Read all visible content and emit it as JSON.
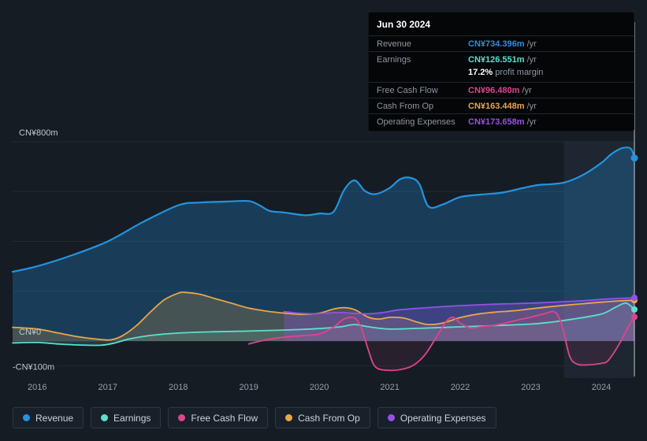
{
  "tooltip": {
    "date": "Jun 30 2024",
    "rows": [
      {
        "label": "Revenue",
        "value": "CN¥734.396m",
        "suffix": "/yr",
        "color": "#2394DF"
      },
      {
        "label": "Earnings",
        "value": "CN¥126.551m",
        "suffix": "/yr",
        "color": "#5BE0CE"
      },
      {
        "label": "Free Cash Flow",
        "value": "CN¥96.480m",
        "suffix": "/yr",
        "color": "#E0448C"
      },
      {
        "label": "Cash From Op",
        "value": "CN¥163.448m",
        "suffix": "/yr",
        "color": "#E9A64C"
      },
      {
        "label": "Operating Expenses",
        "value": "CN¥173.658m",
        "suffix": "/yr",
        "color": "#9650E8"
      }
    ],
    "profit_margin": {
      "value": "17.2%",
      "text": "profit margin"
    }
  },
  "chart_data": {
    "type": "area",
    "unit": "CN¥ millions per year",
    "x_ticks": [
      "2016",
      "2017",
      "2018",
      "2019",
      "2020",
      "2021",
      "2022",
      "2023",
      "2024"
    ],
    "y_ticks": [
      {
        "value": 800,
        "label": "CN¥800m"
      },
      {
        "value": 0,
        "label": "CN¥0"
      },
      {
        "value": -100,
        "label": "-CN¥100m"
      }
    ],
    "gridline_values": [
      800,
      600,
      400,
      200,
      0,
      -100
    ],
    "x_range": [
      2015.65,
      2024.47
    ],
    "y_range": [
      -150,
      800
    ],
    "highlight_region": {
      "from": 2023.47,
      "to": 2024.47
    },
    "series": [
      {
        "name": "Revenue",
        "color": "#2394DF",
        "current": "CN¥734.396m /yr",
        "points": [
          [
            2015.65,
            278
          ],
          [
            2016,
            300
          ],
          [
            2016.5,
            345
          ],
          [
            2017,
            400
          ],
          [
            2017.5,
            478
          ],
          [
            2018,
            545
          ],
          [
            2018.3,
            556
          ],
          [
            2018.7,
            560
          ],
          [
            2019,
            562
          ],
          [
            2019.15,
            545
          ],
          [
            2019.3,
            522
          ],
          [
            2019.5,
            516
          ],
          [
            2019.8,
            505
          ],
          [
            2020,
            512
          ],
          [
            2020.2,
            518
          ],
          [
            2020.35,
            605
          ],
          [
            2020.5,
            645
          ],
          [
            2020.65,
            602
          ],
          [
            2020.8,
            590
          ],
          [
            2021,
            615
          ],
          [
            2021.15,
            650
          ],
          [
            2021.3,
            655
          ],
          [
            2021.42,
            630
          ],
          [
            2021.55,
            540
          ],
          [
            2021.75,
            548
          ],
          [
            2022,
            578
          ],
          [
            2022.3,
            588
          ],
          [
            2022.6,
            596
          ],
          [
            2022.9,
            615
          ],
          [
            2023.1,
            626
          ],
          [
            2023.3,
            630
          ],
          [
            2023.5,
            638
          ],
          [
            2023.75,
            668
          ],
          [
            2024,
            715
          ],
          [
            2024.15,
            752
          ],
          [
            2024.3,
            775
          ],
          [
            2024.42,
            772
          ],
          [
            2024.47,
            734.396
          ]
        ]
      },
      {
        "name": "Earnings",
        "color": "#5BE0CE",
        "current": "CN¥126.551m /yr",
        "points": [
          [
            2015.65,
            -8
          ],
          [
            2016,
            -6
          ],
          [
            2016.3,
            -12
          ],
          [
            2016.6,
            -16
          ],
          [
            2016.9,
            -17
          ],
          [
            2017.1,
            -8
          ],
          [
            2017.3,
            8
          ],
          [
            2017.6,
            22
          ],
          [
            2018,
            32
          ],
          [
            2018.5,
            37
          ],
          [
            2019,
            40
          ],
          [
            2019.5,
            44
          ],
          [
            2020,
            50
          ],
          [
            2020.3,
            57
          ],
          [
            2020.5,
            66
          ],
          [
            2020.7,
            57
          ],
          [
            2021,
            48
          ],
          [
            2021.5,
            52
          ],
          [
            2022,
            57
          ],
          [
            2022.5,
            62
          ],
          [
            2023,
            68
          ],
          [
            2023.3,
            76
          ],
          [
            2023.6,
            88
          ],
          [
            2024,
            108
          ],
          [
            2024.2,
            135
          ],
          [
            2024.35,
            152
          ],
          [
            2024.47,
            126.551
          ]
        ]
      },
      {
        "name": "Free Cash Flow",
        "color": "#E0448C",
        "current": "CN¥96.480m /yr",
        "points": [
          [
            2019,
            -12
          ],
          [
            2019.2,
            2
          ],
          [
            2019.4,
            12
          ],
          [
            2019.6,
            18
          ],
          [
            2019.8,
            22
          ],
          [
            2020,
            28
          ],
          [
            2020.2,
            55
          ],
          [
            2020.35,
            88
          ],
          [
            2020.5,
            92
          ],
          [
            2020.6,
            50
          ],
          [
            2020.7,
            -40
          ],
          [
            2020.8,
            -105
          ],
          [
            2021,
            -118
          ],
          [
            2021.2,
            -112
          ],
          [
            2021.35,
            -95
          ],
          [
            2021.5,
            -55
          ],
          [
            2021.65,
            10
          ],
          [
            2021.8,
            78
          ],
          [
            2021.9,
            95
          ],
          [
            2022,
            72
          ],
          [
            2022.15,
            52
          ],
          [
            2022.3,
            58
          ],
          [
            2022.5,
            64
          ],
          [
            2022.75,
            80
          ],
          [
            2023,
            96
          ],
          [
            2023.2,
            110
          ],
          [
            2023.35,
            115
          ],
          [
            2023.45,
            55
          ],
          [
            2023.55,
            -60
          ],
          [
            2023.65,
            -92
          ],
          [
            2023.8,
            -96
          ],
          [
            2024,
            -90
          ],
          [
            2024.1,
            -78
          ],
          [
            2024.25,
            -15
          ],
          [
            2024.38,
            55
          ],
          [
            2024.47,
            96.48
          ]
        ]
      },
      {
        "name": "Cash From Op",
        "color": "#E9A64C",
        "current": "CN¥163.448m /yr",
        "points": [
          [
            2015.65,
            55
          ],
          [
            2016,
            48
          ],
          [
            2016.3,
            32
          ],
          [
            2016.6,
            16
          ],
          [
            2016.9,
            6
          ],
          [
            2017.05,
            5
          ],
          [
            2017.2,
            20
          ],
          [
            2017.4,
            60
          ],
          [
            2017.6,
            115
          ],
          [
            2017.8,
            165
          ],
          [
            2018,
            192
          ],
          [
            2018.1,
            195
          ],
          [
            2018.3,
            188
          ],
          [
            2018.5,
            172
          ],
          [
            2018.75,
            152
          ],
          [
            2019,
            132
          ],
          [
            2019.25,
            120
          ],
          [
            2019.5,
            112
          ],
          [
            2019.75,
            107
          ],
          [
            2020,
            112
          ],
          [
            2020.2,
            128
          ],
          [
            2020.35,
            134
          ],
          [
            2020.5,
            126
          ],
          [
            2020.7,
            95
          ],
          [
            2020.85,
            88
          ],
          [
            2021,
            95
          ],
          [
            2021.2,
            92
          ],
          [
            2021.4,
            75
          ],
          [
            2021.55,
            66
          ],
          [
            2021.75,
            72
          ],
          [
            2022,
            94
          ],
          [
            2022.25,
            108
          ],
          [
            2022.5,
            116
          ],
          [
            2022.75,
            121
          ],
          [
            2023,
            129
          ],
          [
            2023.25,
            137
          ],
          [
            2023.5,
            144
          ],
          [
            2023.75,
            150
          ],
          [
            2024,
            156
          ],
          [
            2024.25,
            161
          ],
          [
            2024.47,
            163.448
          ]
        ]
      },
      {
        "name": "Operating Expenses",
        "color": "#9650E8",
        "current": "CN¥173.658m /yr",
        "points": [
          [
            2019.5,
            118
          ],
          [
            2019.7,
            112
          ],
          [
            2019.9,
            109
          ],
          [
            2020.1,
            112
          ],
          [
            2020.3,
            114
          ],
          [
            2020.5,
            111
          ],
          [
            2020.7,
            109
          ],
          [
            2020.9,
            114
          ],
          [
            2021.1,
            124
          ],
          [
            2021.3,
            129
          ],
          [
            2021.5,
            133
          ],
          [
            2021.75,
            138
          ],
          [
            2022,
            142
          ],
          [
            2022.25,
            145
          ],
          [
            2022.5,
            148
          ],
          [
            2022.75,
            150
          ],
          [
            2023,
            152
          ],
          [
            2023.25,
            155
          ],
          [
            2023.5,
            158
          ],
          [
            2023.75,
            162
          ],
          [
            2024,
            167
          ],
          [
            2024.25,
            171
          ],
          [
            2024.47,
            173.658
          ]
        ]
      }
    ]
  }
}
